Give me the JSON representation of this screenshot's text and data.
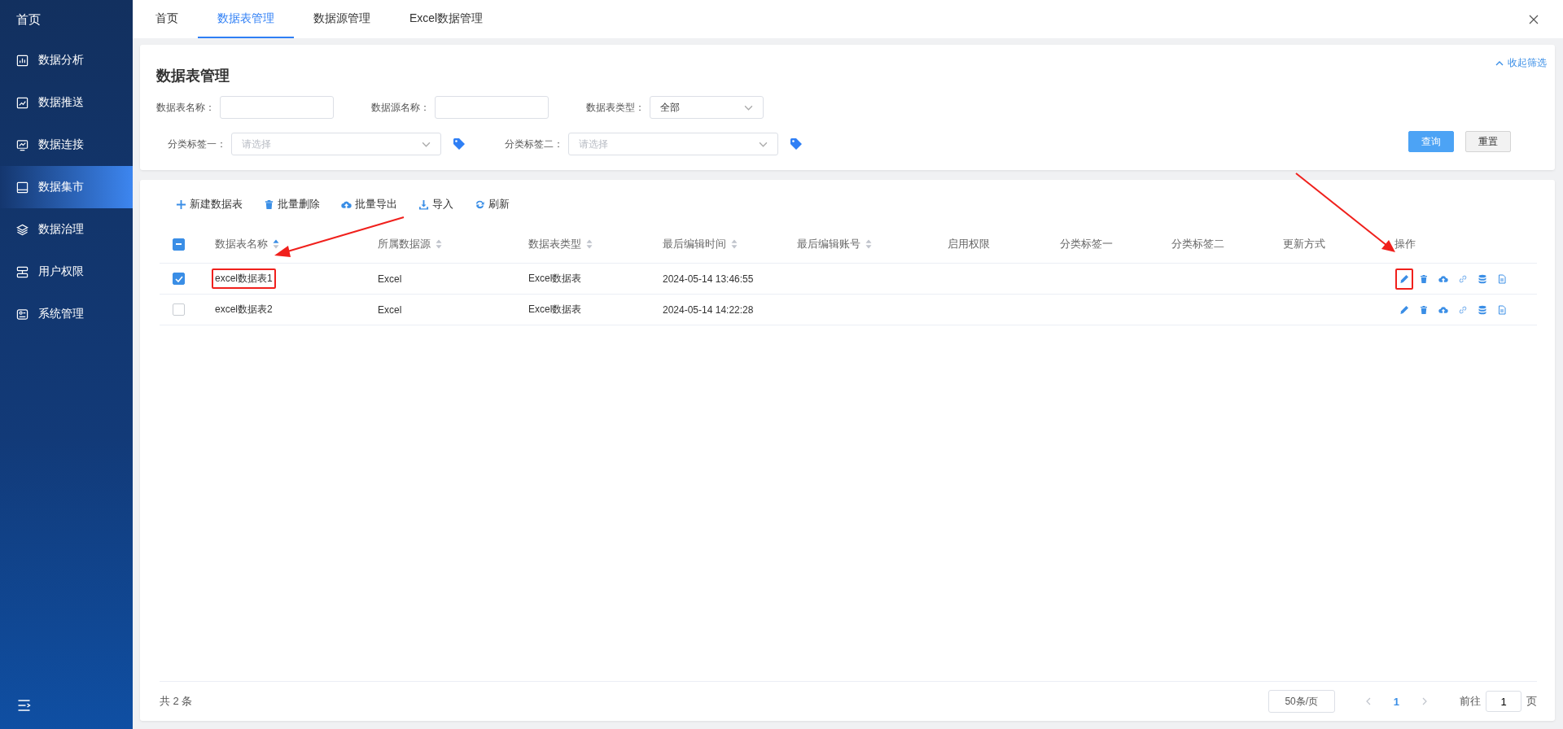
{
  "sidebar": {
    "items": [
      {
        "kind": "home",
        "label": "首页",
        "selected": false
      },
      {
        "kind": "menu",
        "label": "数据分析",
        "selected": false
      },
      {
        "kind": "menu",
        "label": "数据推送",
        "selected": false
      },
      {
        "kind": "menu",
        "label": "数据连接",
        "selected": false
      },
      {
        "kind": "menu",
        "label": "数据集市",
        "selected": true
      },
      {
        "kind": "menu",
        "label": "数据治理",
        "selected": false
      },
      {
        "kind": "menu",
        "label": "用户权限",
        "selected": false
      },
      {
        "kind": "menu",
        "label": "系统管理",
        "selected": false
      }
    ]
  },
  "tabs": [
    {
      "label": "首页",
      "selected": false
    },
    {
      "label": "数据表管理",
      "selected": true
    },
    {
      "label": "数据源管理",
      "selected": false
    },
    {
      "label": "Excel数据管理",
      "selected": false
    }
  ],
  "filter_panel": {
    "title": "数据表管理",
    "collapse_link": "收起筛选",
    "rows": [
      [
        {
          "kind": "input",
          "label": "数据表名称："
        },
        {
          "kind": "input",
          "label": "数据源名称："
        },
        {
          "kind": "select",
          "label": "数据表类型：",
          "value": "全部"
        }
      ],
      [
        {
          "kind": "tag-select",
          "label": "分类标签一：",
          "placeholder": "请选择"
        },
        {
          "kind": "tag-select",
          "label": "分类标签二：",
          "placeholder": "请选择"
        }
      ]
    ],
    "buttons": [
      {
        "kind": "primary",
        "label": "查询"
      },
      {
        "kind": "default",
        "label": "重置"
      }
    ]
  },
  "toolbar": [
    {
      "kind": "add",
      "label": "新建数据表"
    },
    {
      "kind": "delete",
      "label": "批量删除"
    },
    {
      "kind": "export",
      "label": "批量导出"
    },
    {
      "kind": "import",
      "label": "导入"
    },
    {
      "kind": "refresh",
      "label": "刷新"
    }
  ],
  "table": {
    "select_all": {
      "indeterminate": true
    },
    "columns": [
      {
        "title": "数据表名称",
        "sortable": true,
        "sorted_ascending": true
      },
      {
        "title": "所属数据源",
        "sortable": true,
        "sorted_ascending": false
      },
      {
        "title": "数据表类型",
        "sortable": true,
        "sorted_ascending": false
      },
      {
        "title": "最后编辑时间",
        "sortable": true,
        "sorted_ascending": false
      },
      {
        "title": "最后编辑账号",
        "sortable": true,
        "sorted_ascending": false
      },
      {
        "title": "启用权限"
      },
      {
        "title": "分类标签一"
      },
      {
        "title": "分类标签二"
      },
      {
        "title": "更新方式"
      },
      {
        "title": "操作"
      }
    ],
    "rows": [
      {
        "checked": true,
        "name": "excel数据表1",
        "name_highlighted": true,
        "source": "Excel",
        "type": "Excel数据表",
        "edited_at": "2024-05-14 13:46:55",
        "edit_highlighted": true
      },
      {
        "checked": false,
        "name": "excel数据表2",
        "name_highlighted": false,
        "source": "Excel",
        "type": "Excel数据表",
        "edited_at": "2024-05-14 14:22:28",
        "edit_highlighted": false
      }
    ]
  },
  "pagination": {
    "total": "共 2 条",
    "page_size": "50条/页",
    "current_page": "1",
    "goto_label": "前往",
    "goto_value": "1",
    "page_unit": "页"
  }
}
